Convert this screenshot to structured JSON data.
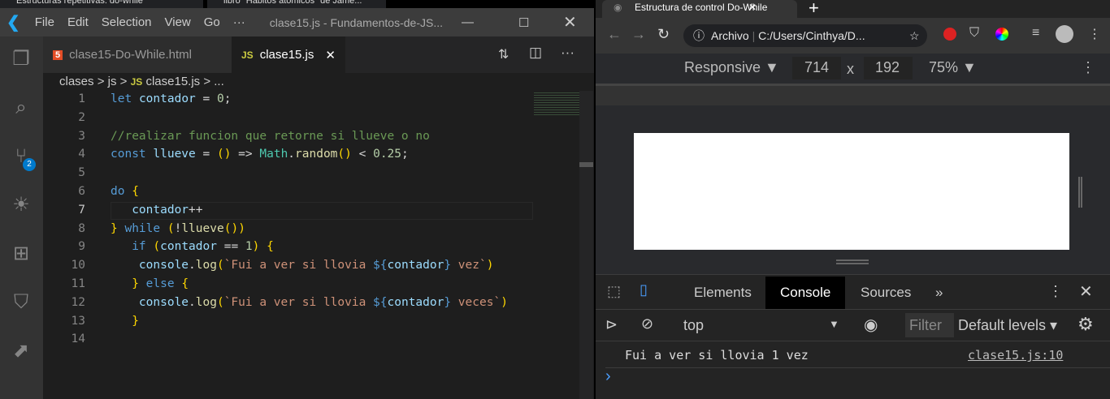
{
  "os_tabs": [
    "Estructuras repetitivas: do-while",
    "libro \"Hábitos atómicos\" de Jame..."
  ],
  "vscode": {
    "menu": [
      "File",
      "Edit",
      "Selection",
      "View",
      "Go",
      "···"
    ],
    "window_title": "clase15.js - Fundamentos-de-JS...",
    "tabs": [
      {
        "label": "clase15-Do-While.html",
        "icon": "html5-icon"
      },
      {
        "label": "clase15.js",
        "icon": "js-icon"
      }
    ],
    "breadcrumb": [
      "clases",
      ">",
      "js",
      ">",
      "JS",
      "clase15.js",
      ">",
      "..."
    ],
    "badge": "2",
    "code_lines": [
      "let contador = 0;",
      "",
      "//realizar funcion que retorne si llueve o no",
      "const llueve = () => Math.random() < 0.25;",
      "",
      "do {",
      "   contador++",
      "} while (!llueve())",
      "   if (contador == 1) {",
      "    console.log(`Fui a ver si llovia ${contador} vez`)",
      "   } else {",
      "    console.log(`Fui a ver si llovia ${contador} veces`)",
      "   }",
      ""
    ],
    "line_numbers": [
      "1",
      "2",
      "3",
      "4",
      "5",
      "6",
      "7",
      "8",
      "9",
      "10",
      "11",
      "12",
      "13",
      "14"
    ]
  },
  "chrome": {
    "tab_title": "Estructura de control Do-While",
    "omnibox_prefix": "Archivo",
    "url": "C:/Users/Cinthya/D...",
    "device": "Responsive ▼",
    "width": "714",
    "times": "x",
    "height": "192",
    "zoom": "75% ▼",
    "devtools_tabs": [
      "Elements",
      "Console",
      "Sources",
      "»"
    ],
    "context": "top",
    "filter_placeholder": "Filter",
    "levels": "Default levels ▾",
    "log": {
      "message": "Fui a ver si llovia 1 vez",
      "source": "clase15.js:10"
    },
    "prompt": "›"
  }
}
